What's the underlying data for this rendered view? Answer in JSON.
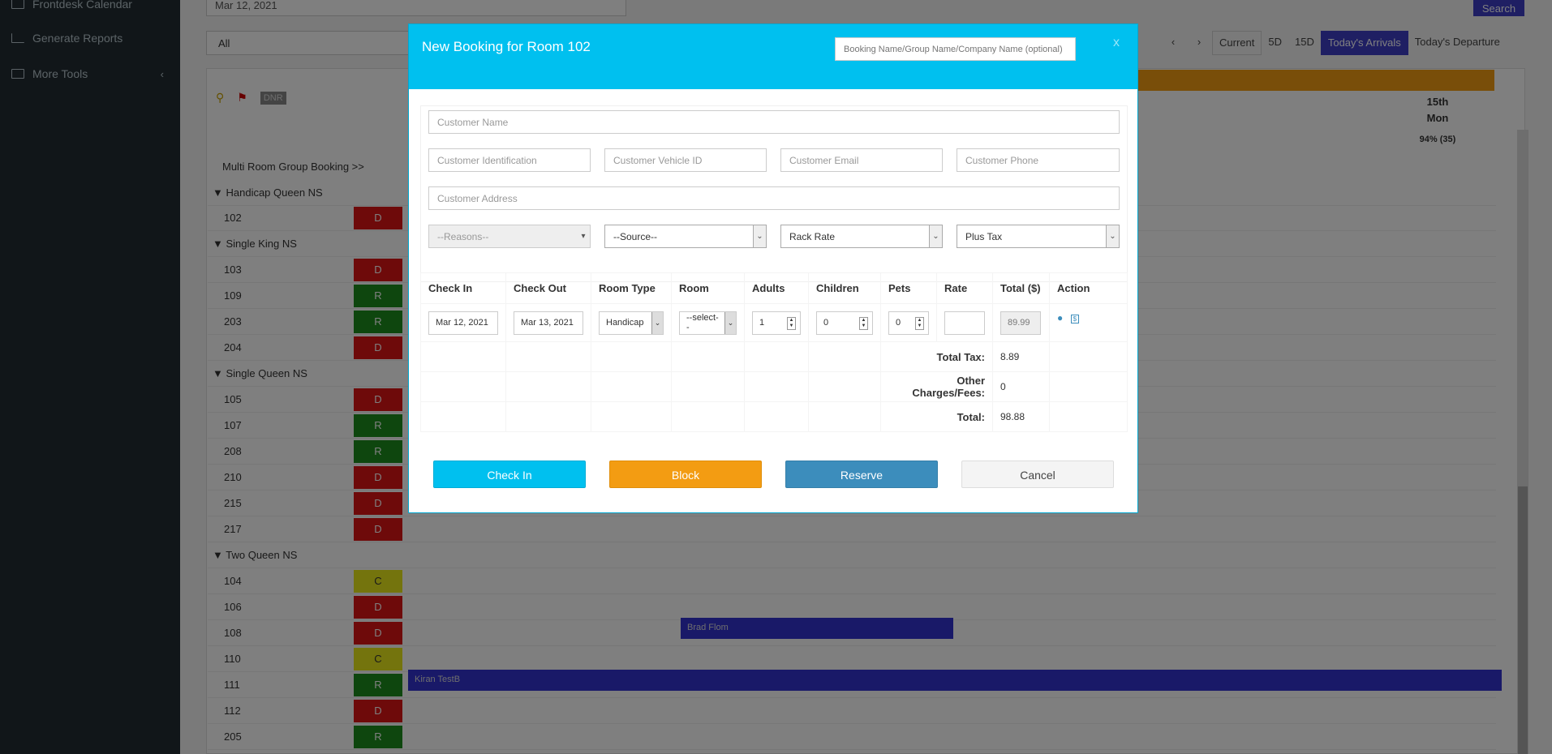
{
  "sidebar": {
    "items": [
      {
        "label": "Frontdesk Calendar"
      },
      {
        "label": "Generate Reports"
      },
      {
        "label": "More Tools"
      }
    ]
  },
  "topbar": {
    "date": "Mar 12, 2021",
    "search_label": "Search",
    "filter": "All"
  },
  "toolbar": {
    "current": "Current",
    "five_d": "5D",
    "fifteen_d": "15D",
    "arrivals": "Today's Arrivals",
    "departures": "Today's Departure"
  },
  "calendar": {
    "day_num": "15th",
    "day_name": "Mon",
    "occupancy": "94% (35)",
    "dnr_label": "DNR",
    "multi_room": "Multi Room Group Booking >>",
    "groups": [
      {
        "name": "Handicap Queen NS"
      },
      {
        "name": "Single King NS"
      },
      {
        "name": "Single Queen NS"
      },
      {
        "name": "Two Queen NS"
      }
    ],
    "rooms": [
      {
        "num": "102",
        "status": "D"
      },
      {
        "num": "103",
        "status": "D"
      },
      {
        "num": "109",
        "status": "R"
      },
      {
        "num": "203",
        "status": "R"
      },
      {
        "num": "204",
        "status": "D"
      },
      {
        "num": "105",
        "status": "D"
      },
      {
        "num": "107",
        "status": "R"
      },
      {
        "num": "208",
        "status": "R"
      },
      {
        "num": "210",
        "status": "D"
      },
      {
        "num": "215",
        "status": "D"
      },
      {
        "num": "217",
        "status": "D"
      },
      {
        "num": "104",
        "status": "C"
      },
      {
        "num": "106",
        "status": "D"
      },
      {
        "num": "108",
        "status": "D"
      },
      {
        "num": "110",
        "status": "C"
      },
      {
        "num": "111",
        "status": "R"
      },
      {
        "num": "112",
        "status": "D"
      },
      {
        "num": "205",
        "status": "R"
      }
    ],
    "bookings": [
      {
        "guest": "Brad Flom"
      },
      {
        "guest": "Kiran TestB"
      }
    ]
  },
  "modal": {
    "title": "New Booking for Room 102",
    "booking_name_placeholder": "Booking Name/Group Name/Company Name (optional)",
    "close": "x",
    "placeholders": {
      "customer_name": "Customer Name",
      "customer_id": "Customer Identification",
      "vehicle_id": "Customer Vehicle ID",
      "email": "Customer Email",
      "phone": "Customer Phone",
      "address": "Customer Address"
    },
    "selects": {
      "reasons": "--Reasons--",
      "source": "--Source--",
      "rate_type": "Rack Rate",
      "tax": "Plus Tax"
    },
    "table": {
      "headers": [
        "Check In",
        "Check Out",
        "Room Type",
        "Room",
        "Adults",
        "Children",
        "Pets",
        "Rate",
        "Total ($)",
        "Action"
      ],
      "row": {
        "check_in": "Mar 12, 2021",
        "check_out": "Mar 13, 2021",
        "room_type": "Handicap",
        "room": "--select--",
        "adults": "1",
        "children": "0",
        "pets": "0",
        "rate": "",
        "total": "89.99"
      },
      "total_tax_label": "Total Tax:",
      "total_tax": "8.89",
      "other_label": "Other Charges/Fees:",
      "other": "0",
      "total_label": "Total:",
      "total": "98.88"
    },
    "buttons": {
      "check_in": "Check In",
      "block": "Block",
      "reserve": "Reserve",
      "cancel": "Cancel"
    }
  }
}
